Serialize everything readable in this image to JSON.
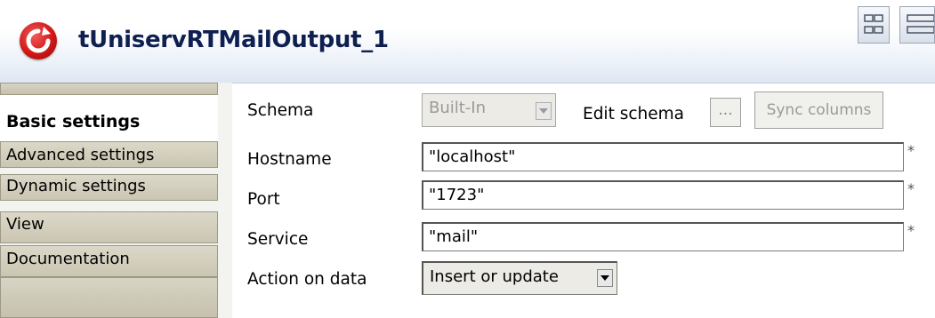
{
  "header": {
    "title": "tUniservRTMailOutput_1"
  },
  "tabs": [
    {
      "label": "Basic settings"
    },
    {
      "label": "Advanced settings"
    },
    {
      "label": "Dynamic settings"
    },
    {
      "label": "View"
    },
    {
      "label": "Documentation"
    }
  ],
  "form": {
    "schema_label": "Schema",
    "schema_value": "Built-In",
    "edit_schema_label": "Edit schema",
    "edit_schema_button": "...",
    "sync_columns_button": "Sync columns",
    "hostname_label": "Hostname",
    "hostname_value": "\"localhost\"",
    "port_label": "Port",
    "port_value": "\"1723\"",
    "service_label": "Service",
    "service_value": "\"mail\"",
    "action_label": "Action on data",
    "action_value": "Insert or update",
    "required_marker": "*"
  },
  "colors": {
    "brand": "#d11818",
    "title_text": "#0f1f50"
  },
  "icons": [
    "refresh-logo-icon",
    "grid-layout-icon",
    "list-layout-icon",
    "chevron-down-icon"
  ]
}
